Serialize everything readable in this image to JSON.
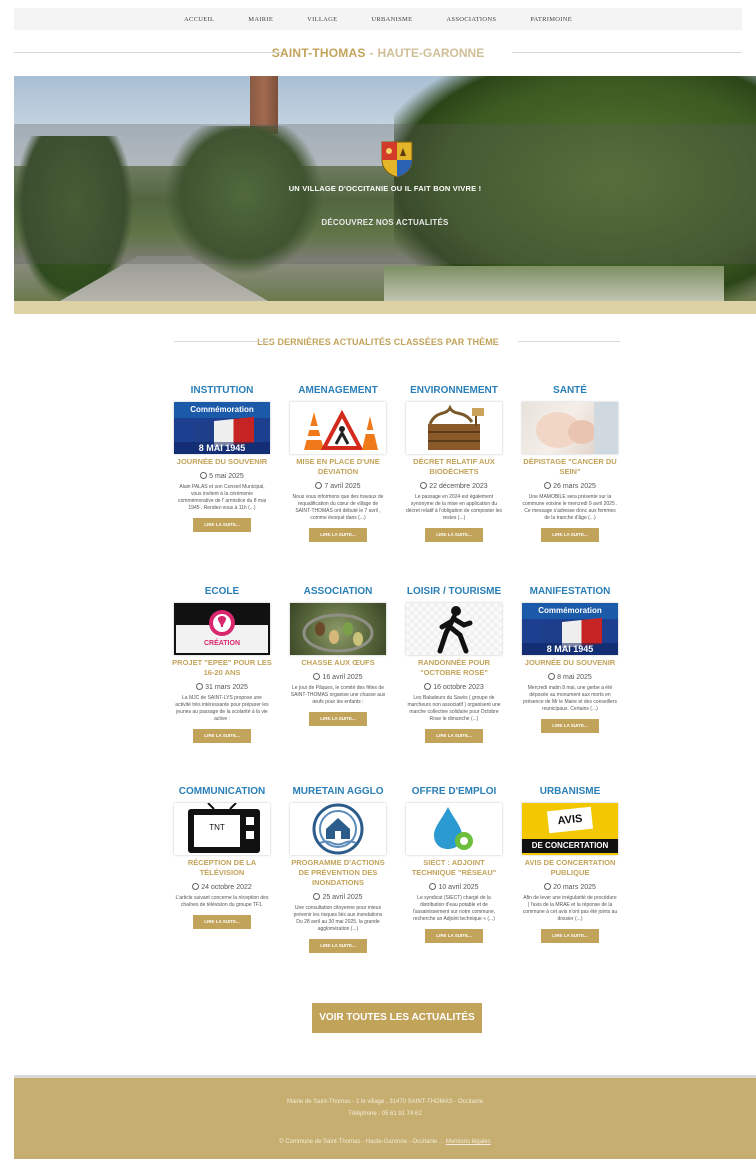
{
  "nav": {
    "items": [
      "ACCUEIL",
      "MAIRIE",
      "VILLAGE",
      "URBANISME",
      "ASSOCIATIONS",
      "PATRIMOINE"
    ]
  },
  "site": {
    "title_main": "SAINT-THOMAS",
    "title_sep": "-",
    "title_sub": "HAUTE-GARONNE"
  },
  "hero": {
    "slogan": "UN VILLAGE D'OCCITANIE OU IL FAIT BON VIVRE !",
    "cta": "DÉCOUVREZ NOS ACTUALITÉS"
  },
  "section_title": "LES DERNIÈRES ACTUALITÉS CLASSÉES PAR THÈME",
  "cards": [
    {
      "theme": "INSTITUTION",
      "title": "JOURNÉE DU SOUVENIR",
      "date": "5 mai 2025",
      "desc": "Alain PALAS et son Conseil Municipal, vous invitent à la cérémonie commémorative de l' armistice du 8 mai 1945 . Rendez-vous à 11h (...)",
      "button": "LIRE LA SUITE...",
      "thumb_text": [
        "Commémoration",
        "8 MAI 1945"
      ],
      "thumb_icon": "commemoration-image"
    },
    {
      "theme": "AMENAGEMENT",
      "title": "MISE EN PLACE D'UNE DÉVIATION",
      "date": "7 avril 2025",
      "desc": "Nous vous informons que des travaux de requalification du cœur de village de SAINT-THOMAS ont débuté le 7 avril , comme évoqué dans (...)",
      "button": "LIRE LA SUITE...",
      "thumb_icon": "roadworks-image"
    },
    {
      "theme": "ENVIRONNEMENT",
      "title": "DÉCRET RELATIF AUX BIODÉCHETS",
      "date": "22 décembre 2023",
      "desc": "Le passage en 2024 est également synonyme de la mise en application du décret relatif à l'obligation de composter les restes (...)",
      "button": "LIRE LA SUITE...",
      "thumb_icon": "compost-image"
    },
    {
      "theme": "SANTÉ",
      "title": "DÉPISTAGE \"CANCER DU SEIN\"",
      "date": "26 mars 2025",
      "desc": "Une MAMOBILE sera présente sur la commune voisine le mercredi 9 avril 2025 . Ce message s'adresse donc aux femmes de la tranche d'âge (...)",
      "button": "LIRE LA SUITE...",
      "thumb_icon": "health-image"
    },
    {
      "theme": "ECOLE",
      "title": "PROJET \"EPEE\" POUR LES 16-20 ANS",
      "date": "31 mars 2025",
      "desc": "La MJC de SAINT-LYS propose une activité très intéressante pour préparer les jeunes au passage de la scolarité à la vie active :",
      "button": "LIRE LA SUITE...",
      "thumb_text": [
        "CRÉATION"
      ],
      "thumb_icon": "lightbulb-icon"
    },
    {
      "theme": "ASSOCIATION",
      "title": "CHASSE AUX ŒUFS",
      "date": "16 avril 2025",
      "desc": "Le jour de Pâques, le comité des fêtes de SAINT-THOMAS organise une chasse aux œufs pour les enfants :",
      "button": "LIRE LA SUITE...",
      "thumb_icon": "easter-eggs-image"
    },
    {
      "theme": "LOISIR / TOURISME",
      "title": "RANDONNÉE POUR \"OCTOBRE ROSE\"",
      "date": "16 octobre 2023",
      "desc": "Les Baladeurs du Savès ( groupe de marcheurs non associatif ) organisent une marche collective solidaire pour Octobre Rose le dimanche (...)",
      "button": "LIRE LA SUITE...",
      "thumb_icon": "walker-icon"
    },
    {
      "theme": "MANIFESTATION",
      "title": "JOURNÉE DU SOUVENIR",
      "date": "8 mai 2025",
      "desc": "Mercredi matin 8 mai, une gerbe a été déposée au monument aux morts en présence de Mr le Maire et des conseillers municipaux. Certains (...)",
      "button": "LIRE LA SUITE...",
      "thumb_text": [
        "Commémoration",
        "8 MAI 1945"
      ],
      "thumb_icon": "commemoration-image"
    },
    {
      "theme": "COMMUNICATION",
      "title": "RÉCEPTION DE LA TÉLÉVISION",
      "date": "24 octobre 2022",
      "desc": "L'article suivant concerne la réception des chaînes de télévision du groupe TF1.",
      "button": "LIRE LA SUITE...",
      "thumb_text": [
        "TNT"
      ],
      "thumb_icon": "tv-icon"
    },
    {
      "theme": "MURETAIN AGGLO",
      "title": "PROGRAMME D'ACTIONS DE PRÉVENTION DES INONDATIONS",
      "date": "25 avril 2025",
      "desc": "Une consultation citoyenne pour mieux prévenir les risques liés aux inondations Du 28 avril au 30 mai 2025, la grande agglomération (...)",
      "button": "LIRE LA SUITE...",
      "thumb_icon": "flood-house-icon"
    },
    {
      "theme": "OFFRE D'EMPLOI",
      "title": "SIECT : ADJOINT TECHNIQUE \"RÉSEAU\"",
      "date": "10 avril 2025",
      "desc": "Le syndicat (SIECT) chargé de la distribution d'eau potable et de l'assainissement sur notre commune, recherche un Adjoint technique « (...)",
      "button": "LIRE LA SUITE...",
      "thumb_icon": "water-gear-icon"
    },
    {
      "theme": "URBANISME",
      "title": "AVIS DE CONCERTATION PUBLIQUE",
      "date": "20 mars 2025",
      "desc": "Afin de lever une irrégularité de procédure ( l'avis de la MRAE et la réponse de la commune à cet avis n'ont pas été joints au dossier (...)",
      "button": "LIRE LA SUITE...",
      "thumb_text": [
        "AVIS",
        "DE CONCERTATION"
      ],
      "thumb_icon": "notice-image"
    }
  ],
  "all_news_button": "VOIR TOUTES LES ACTUALITÉS",
  "footer": {
    "address": "Mairie de Saint-Thomas - 1 le village , 31470 SAINT-THOMAS - Occitanie",
    "phone": "Téléphone : 05 61 91 74 62",
    "copyright": "© Commune de Saint-Thomas - Haute-Garonne - Occitanie .:.",
    "legal_link": "Mentions légales"
  },
  "colors": {
    "accent_gold": "#c2a35a",
    "theme_blue": "#2a7fb8",
    "footer_bg": "#c5ae70"
  }
}
